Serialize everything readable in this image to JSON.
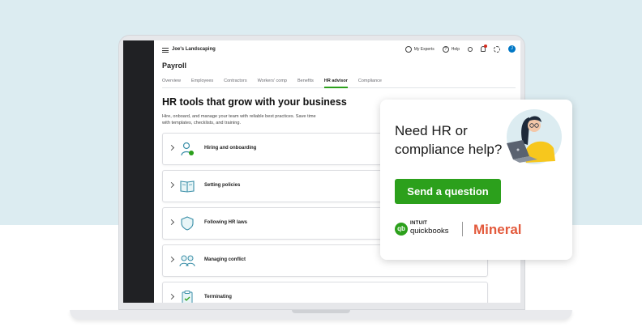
{
  "app": {
    "company_name": "Joe's Landscaping",
    "page_title": "Payroll",
    "topbar": {
      "my_experts_label": "My Experts",
      "help_label": "Help",
      "avatar_initial": "J"
    },
    "tabs": [
      {
        "label": "Overview",
        "active": false
      },
      {
        "label": "Employees",
        "active": false
      },
      {
        "label": "Contractors",
        "active": false
      },
      {
        "label": "Workers' comp",
        "active": false
      },
      {
        "label": "Benefits",
        "active": false
      },
      {
        "label": "HR advisor",
        "active": true
      },
      {
        "label": "Compliance",
        "active": false
      }
    ],
    "heading": "HR tools that grow with your business",
    "subtext": "Hire, onboard, and manage your team with reliable best practices. Save time with templates, checklists, and training.",
    "cards": [
      {
        "label": "Hiring and onboarding",
        "icon": "hiring-icon"
      },
      {
        "label": "Setting policies",
        "icon": "book-icon"
      },
      {
        "label": "Following HR laws",
        "icon": "shield-icon"
      },
      {
        "label": "Managing conflict",
        "icon": "people-icon"
      },
      {
        "label": "Terminating",
        "icon": "clipboard-icon"
      }
    ]
  },
  "popup": {
    "title": "Need HR or compliance help?",
    "button_label": "Send a question",
    "quickbooks_top": "INTUIT",
    "quickbooks_text": "quickbooks",
    "quickbooks_mark": "qb",
    "mineral_text": "Mineral"
  },
  "colors": {
    "accent_green": "#2ca01c",
    "background_band": "#dcecf1",
    "mineral_orange": "#e35a3c",
    "illustration_yellow": "#f7c71d"
  }
}
